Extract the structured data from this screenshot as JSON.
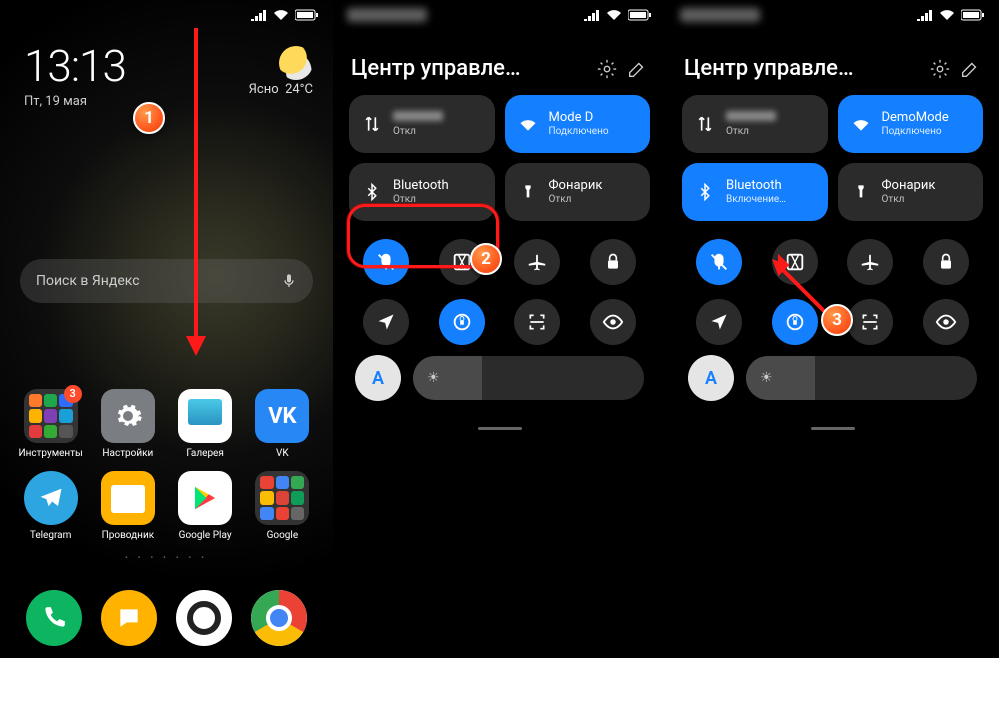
{
  "steps": {
    "s1": "1",
    "s2": "2",
    "s3": "3"
  },
  "home": {
    "time": "13:13",
    "date": "Пт, 19 мая",
    "weather_cond": "Ясно",
    "weather_temp": "24°C",
    "search_placeholder": "Поиск в Яндекс",
    "apps": {
      "tools": "Инструменты",
      "tools_badge": "3",
      "settings": "Настройки",
      "gallery": "Галерея",
      "vk": "VK",
      "telegram": "Telegram",
      "explorer": "Проводник",
      "play": "Google Play",
      "google": "Google"
    },
    "dots": "• • • • • • •"
  },
  "cc": {
    "title": "Центр управле…",
    "mobile": {
      "status": "Откл"
    },
    "wifi2": {
      "name": "Mode   D",
      "status": "Подключено"
    },
    "wifi3": {
      "name": "DemoMode",
      "status": "Подключено"
    },
    "bt2": {
      "name": "Bluetooth",
      "status": "Откл"
    },
    "bt3": {
      "name": "Bluetooth",
      "status": "Включение…"
    },
    "torch": {
      "name": "Фонарик",
      "status": "Откл"
    },
    "auto": "A"
  }
}
